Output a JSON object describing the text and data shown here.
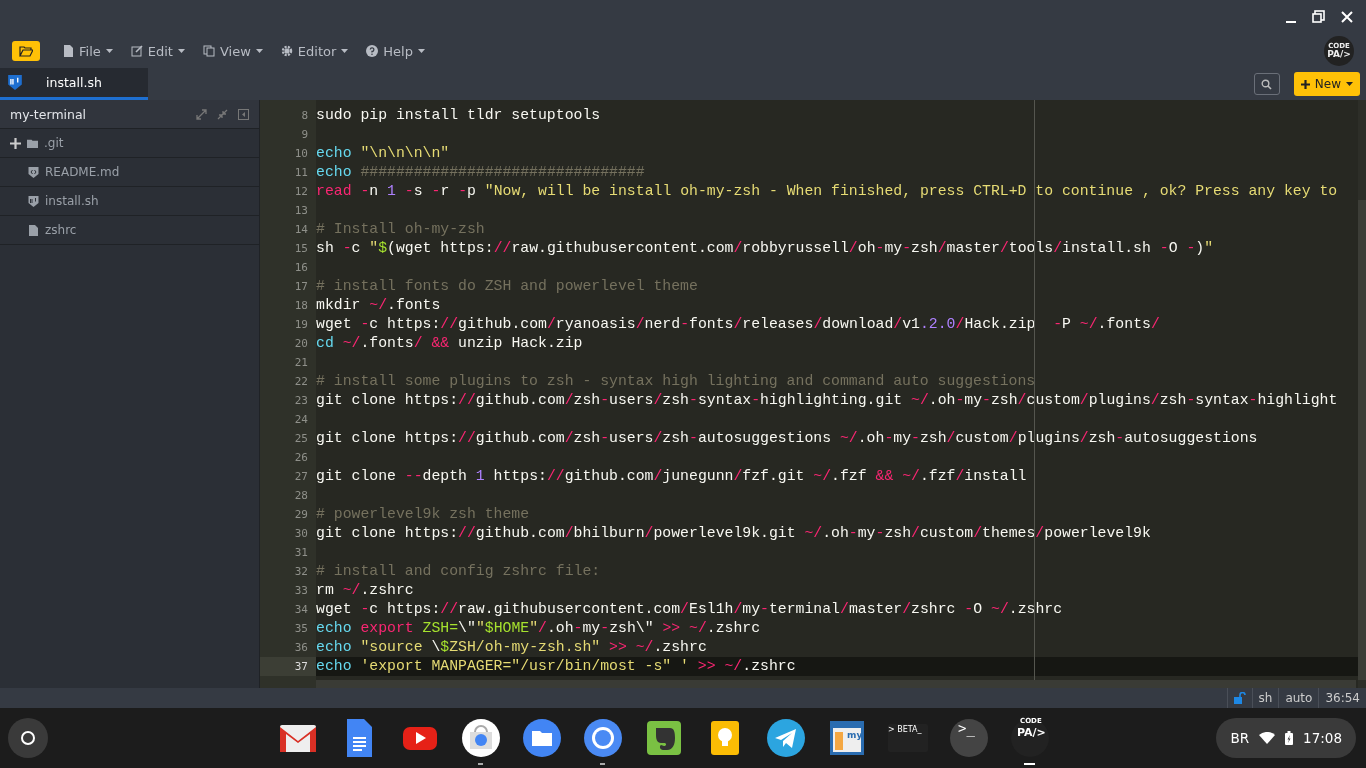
{
  "toolbar": {
    "menus": [
      {
        "label": "File",
        "kind": "file"
      },
      {
        "label": "Edit",
        "kind": "edit"
      },
      {
        "label": "View",
        "kind": "view"
      },
      {
        "label": "Editor",
        "kind": "editor"
      },
      {
        "label": "Help",
        "kind": "help"
      }
    ],
    "logo": {
      "top": "CODE",
      "bottom": "PA/>"
    },
    "new_button": "New"
  },
  "tabs": [
    {
      "label": "install.sh",
      "selected": true
    }
  ],
  "sidebar": {
    "project": "my-terminal",
    "items": [
      {
        "label": ".git",
        "kind": "folder"
      },
      {
        "label": "README.md",
        "kind": "markdown"
      },
      {
        "label": "install.sh",
        "kind": "shell"
      },
      {
        "label": "zshrc",
        "kind": "file"
      }
    ]
  },
  "editor": {
    "lines": [
      {
        "number": "8",
        "active": false,
        "segments": [
          {
            "kind": "plain",
            "text": "sudo pip install tldr setuptools"
          }
        ]
      },
      {
        "number": "9",
        "active": false
      },
      {
        "number": "10",
        "active": false,
        "segments": [
          {
            "kind": "kw",
            "text": "echo "
          },
          {
            "kind": "str",
            "text": "\"\\n\\n\\n\\n\""
          }
        ]
      },
      {
        "number": "11",
        "active": false,
        "segments": [
          {
            "kind": "kw",
            "text": "echo"
          },
          {
            "kind": "comment",
            "text": " ################################"
          }
        ]
      },
      {
        "number": "12",
        "active": false,
        "segments": [
          {
            "kind": "op",
            "text": "read "
          },
          {
            "kind": "op",
            "text": "-"
          },
          {
            "kind": "plain",
            "text": "n "
          },
          {
            "kind": "num",
            "text": "1 "
          },
          {
            "kind": "op",
            "text": "-"
          },
          {
            "kind": "plain",
            "text": "s "
          },
          {
            "kind": "op",
            "text": "-"
          },
          {
            "kind": "plain",
            "text": "r "
          },
          {
            "kind": "op",
            "text": "-"
          },
          {
            "kind": "plain",
            "text": "p "
          },
          {
            "kind": "str",
            "text": "\"Now, will be install oh-my-zsh - When finished, press CTRL+D to continue , ok? Press any key to"
          }
        ]
      },
      {
        "number": "13",
        "active": false
      },
      {
        "number": "14",
        "active": false,
        "segments": [
          {
            "kind": "comment",
            "text": "# Install oh-my-zsh"
          }
        ]
      },
      {
        "number": "15",
        "active": false,
        "segments": [
          {
            "kind": "plain",
            "text": "sh "
          },
          {
            "kind": "op",
            "text": "-"
          },
          {
            "kind": "plain",
            "text": "c "
          },
          {
            "kind": "str",
            "text": "\""
          },
          {
            "kind": "green",
            "text": "$"
          },
          {
            "kind": "plain",
            "text": "(wget https:"
          },
          {
            "kind": "op",
            "text": "//"
          },
          {
            "kind": "plain",
            "text": "raw.githubusercontent.com"
          },
          {
            "kind": "op",
            "text": "/"
          },
          {
            "kind": "plain",
            "text": "robbyrussell"
          },
          {
            "kind": "op",
            "text": "/"
          },
          {
            "kind": "plain",
            "text": "oh"
          },
          {
            "kind": "op",
            "text": "-"
          },
          {
            "kind": "plain",
            "text": "my"
          },
          {
            "kind": "op",
            "text": "-"
          },
          {
            "kind": "plain",
            "text": "zsh"
          },
          {
            "kind": "op",
            "text": "/"
          },
          {
            "kind": "plain",
            "text": "master"
          },
          {
            "kind": "op",
            "text": "/"
          },
          {
            "kind": "plain",
            "text": "tools"
          },
          {
            "kind": "op",
            "text": "/"
          },
          {
            "kind": "plain",
            "text": "install.sh "
          },
          {
            "kind": "op",
            "text": "-"
          },
          {
            "kind": "plain",
            "text": "O "
          },
          {
            "kind": "op",
            "text": "-"
          },
          {
            "kind": "plain",
            "text": ")"
          },
          {
            "kind": "str",
            "text": "\""
          }
        ]
      },
      {
        "number": "16",
        "active": false
      },
      {
        "number": "17",
        "active": false,
        "segments": [
          {
            "kind": "comment",
            "text": "# install fonts do ZSH and powerlevel theme"
          }
        ]
      },
      {
        "number": "18",
        "active": false,
        "segments": [
          {
            "kind": "plain",
            "text": "mkdir "
          },
          {
            "kind": "op",
            "text": "~/"
          },
          {
            "kind": "plain",
            "text": ".fonts"
          }
        ]
      },
      {
        "number": "19",
        "active": false,
        "segments": [
          {
            "kind": "plain",
            "text": "wget "
          },
          {
            "kind": "op",
            "text": "-"
          },
          {
            "kind": "plain",
            "text": "c https:"
          },
          {
            "kind": "op",
            "text": "//"
          },
          {
            "kind": "plain",
            "text": "github.com"
          },
          {
            "kind": "op",
            "text": "/"
          },
          {
            "kind": "plain",
            "text": "ryanoasis"
          },
          {
            "kind": "op",
            "text": "/"
          },
          {
            "kind": "plain",
            "text": "nerd"
          },
          {
            "kind": "op",
            "text": "-"
          },
          {
            "kind": "plain",
            "text": "fonts"
          },
          {
            "kind": "op",
            "text": "/"
          },
          {
            "kind": "plain",
            "text": "releases"
          },
          {
            "kind": "op",
            "text": "/"
          },
          {
            "kind": "plain",
            "text": "download"
          },
          {
            "kind": "op",
            "text": "/"
          },
          {
            "kind": "plain",
            "text": "v1"
          },
          {
            "kind": "num",
            "text": ".2.0"
          },
          {
            "kind": "op",
            "text": "/"
          },
          {
            "kind": "plain",
            "text": "Hack.zip  "
          },
          {
            "kind": "op",
            "text": "-"
          },
          {
            "kind": "plain",
            "text": "P "
          },
          {
            "kind": "op",
            "text": "~/"
          },
          {
            "kind": "plain",
            "text": ".fonts"
          },
          {
            "kind": "op",
            "text": "/"
          }
        ]
      },
      {
        "number": "20",
        "active": false,
        "segments": [
          {
            "kind": "kw",
            "text": "cd "
          },
          {
            "kind": "op",
            "text": "~/"
          },
          {
            "kind": "plain",
            "text": ".fonts"
          },
          {
            "kind": "op",
            "text": "/ &&"
          },
          {
            "kind": "plain",
            "text": " unzip Hack.zip"
          }
        ]
      },
      {
        "number": "21",
        "active": false
      },
      {
        "number": "22",
        "active": false,
        "segments": [
          {
            "kind": "comment",
            "text": "# install some plugins to zsh - syntax high lighting and command auto suggestions"
          }
        ]
      },
      {
        "number": "23",
        "active": false,
        "segments": [
          {
            "kind": "plain",
            "text": "git clone https:"
          },
          {
            "kind": "op",
            "text": "//"
          },
          {
            "kind": "plain",
            "text": "github.com"
          },
          {
            "kind": "op",
            "text": "/"
          },
          {
            "kind": "plain",
            "text": "zsh"
          },
          {
            "kind": "op",
            "text": "-"
          },
          {
            "kind": "plain",
            "text": "users"
          },
          {
            "kind": "op",
            "text": "/"
          },
          {
            "kind": "plain",
            "text": "zsh"
          },
          {
            "kind": "op",
            "text": "-"
          },
          {
            "kind": "plain",
            "text": "syntax"
          },
          {
            "kind": "op",
            "text": "-"
          },
          {
            "kind": "plain",
            "text": "highlighting.git "
          },
          {
            "kind": "op",
            "text": "~/"
          },
          {
            "kind": "plain",
            "text": ".oh"
          },
          {
            "kind": "op",
            "text": "-"
          },
          {
            "kind": "plain",
            "text": "my"
          },
          {
            "kind": "op",
            "text": "-"
          },
          {
            "kind": "plain",
            "text": "zsh"
          },
          {
            "kind": "op",
            "text": "/"
          },
          {
            "kind": "plain",
            "text": "custom"
          },
          {
            "kind": "op",
            "text": "/"
          },
          {
            "kind": "plain",
            "text": "plugins"
          },
          {
            "kind": "op",
            "text": "/"
          },
          {
            "kind": "plain",
            "text": "zsh"
          },
          {
            "kind": "op",
            "text": "-"
          },
          {
            "kind": "plain",
            "text": "syntax"
          },
          {
            "kind": "op",
            "text": "-"
          },
          {
            "kind": "plain",
            "text": "highlight"
          }
        ]
      },
      {
        "number": "24",
        "active": false
      },
      {
        "number": "25",
        "active": false,
        "segments": [
          {
            "kind": "plain",
            "text": "git clone https:"
          },
          {
            "kind": "op",
            "text": "//"
          },
          {
            "kind": "plain",
            "text": "github.com"
          },
          {
            "kind": "op",
            "text": "/"
          },
          {
            "kind": "plain",
            "text": "zsh"
          },
          {
            "kind": "op",
            "text": "-"
          },
          {
            "kind": "plain",
            "text": "users"
          },
          {
            "kind": "op",
            "text": "/"
          },
          {
            "kind": "plain",
            "text": "zsh"
          },
          {
            "kind": "op",
            "text": "-"
          },
          {
            "kind": "plain",
            "text": "autosuggestions "
          },
          {
            "kind": "op",
            "text": "~/"
          },
          {
            "kind": "plain",
            "text": ".oh"
          },
          {
            "kind": "op",
            "text": "-"
          },
          {
            "kind": "plain",
            "text": "my"
          },
          {
            "kind": "op",
            "text": "-"
          },
          {
            "kind": "plain",
            "text": "zsh"
          },
          {
            "kind": "op",
            "text": "/"
          },
          {
            "kind": "plain",
            "text": "custom"
          },
          {
            "kind": "op",
            "text": "/"
          },
          {
            "kind": "plain",
            "text": "plugins"
          },
          {
            "kind": "op",
            "text": "/"
          },
          {
            "kind": "plain",
            "text": "zsh"
          },
          {
            "kind": "op",
            "text": "-"
          },
          {
            "kind": "plain",
            "text": "autosuggestions"
          }
        ]
      },
      {
        "number": "26",
        "active": false
      },
      {
        "number": "27",
        "active": false,
        "segments": [
          {
            "kind": "plain",
            "text": "git clone "
          },
          {
            "kind": "op",
            "text": "--"
          },
          {
            "kind": "plain",
            "text": "depth "
          },
          {
            "kind": "num",
            "text": "1"
          },
          {
            "kind": "plain",
            "text": " https:"
          },
          {
            "kind": "op",
            "text": "//"
          },
          {
            "kind": "plain",
            "text": "github.com"
          },
          {
            "kind": "op",
            "text": "/"
          },
          {
            "kind": "plain",
            "text": "junegunn"
          },
          {
            "kind": "op",
            "text": "/"
          },
          {
            "kind": "plain",
            "text": "fzf.git "
          },
          {
            "kind": "op",
            "text": "~/"
          },
          {
            "kind": "plain",
            "text": ".fzf "
          },
          {
            "kind": "op",
            "text": "&& ~/"
          },
          {
            "kind": "plain",
            "text": ".fzf"
          },
          {
            "kind": "op",
            "text": "/"
          },
          {
            "kind": "plain",
            "text": "install"
          }
        ]
      },
      {
        "number": "28",
        "active": false
      },
      {
        "number": "29",
        "active": false,
        "segments": [
          {
            "kind": "comment",
            "text": "# powerlevel9k zsh theme"
          }
        ]
      },
      {
        "number": "30",
        "active": false,
        "segments": [
          {
            "kind": "plain",
            "text": "git clone https:"
          },
          {
            "kind": "op",
            "text": "//"
          },
          {
            "kind": "plain",
            "text": "github.com"
          },
          {
            "kind": "op",
            "text": "/"
          },
          {
            "kind": "plain",
            "text": "bhilburn"
          },
          {
            "kind": "op",
            "text": "/"
          },
          {
            "kind": "plain",
            "text": "powerlevel9k.git "
          },
          {
            "kind": "op",
            "text": "~/"
          },
          {
            "kind": "plain",
            "text": ".oh"
          },
          {
            "kind": "op",
            "text": "-"
          },
          {
            "kind": "plain",
            "text": "my"
          },
          {
            "kind": "op",
            "text": "-"
          },
          {
            "kind": "plain",
            "text": "zsh"
          },
          {
            "kind": "op",
            "text": "/"
          },
          {
            "kind": "plain",
            "text": "custom"
          },
          {
            "kind": "op",
            "text": "/"
          },
          {
            "kind": "plain",
            "text": "themes"
          },
          {
            "kind": "op",
            "text": "/"
          },
          {
            "kind": "plain",
            "text": "powerlevel9k"
          }
        ]
      },
      {
        "number": "31",
        "active": false
      },
      {
        "number": "32",
        "active": false,
        "segments": [
          {
            "kind": "comment",
            "text": "# install and config zshrc file:"
          }
        ]
      },
      {
        "number": "33",
        "active": false,
        "segments": [
          {
            "kind": "plain",
            "text": "rm "
          },
          {
            "kind": "op",
            "text": "~/"
          },
          {
            "kind": "plain",
            "text": ".zshrc"
          }
        ]
      },
      {
        "number": "34",
        "active": false,
        "segments": [
          {
            "kind": "plain",
            "text": "wget "
          },
          {
            "kind": "op",
            "text": "-"
          },
          {
            "kind": "plain",
            "text": "c https:"
          },
          {
            "kind": "op",
            "text": "//"
          },
          {
            "kind": "plain",
            "text": "raw.githubusercontent.com"
          },
          {
            "kind": "op",
            "text": "/"
          },
          {
            "kind": "plain",
            "text": "Esl1h"
          },
          {
            "kind": "op",
            "text": "/"
          },
          {
            "kind": "plain",
            "text": "my"
          },
          {
            "kind": "op",
            "text": "-"
          },
          {
            "kind": "plain",
            "text": "terminal"
          },
          {
            "kind": "op",
            "text": "/"
          },
          {
            "kind": "plain",
            "text": "master"
          },
          {
            "kind": "op",
            "text": "/"
          },
          {
            "kind": "plain",
            "text": "zshrc "
          },
          {
            "kind": "op",
            "text": "-"
          },
          {
            "kind": "plain",
            "text": "O "
          },
          {
            "kind": "op",
            "text": "~/"
          },
          {
            "kind": "plain",
            "text": ".zshrc"
          }
        ]
      },
      {
        "number": "35",
        "active": false,
        "segments": [
          {
            "kind": "kw",
            "text": "echo "
          },
          {
            "kind": "op",
            "text": "export "
          },
          {
            "kind": "green",
            "text": "ZSH="
          },
          {
            "kind": "plain",
            "text": "\\\""
          },
          {
            "kind": "str",
            "text": "\""
          },
          {
            "kind": "green",
            "text": "$HOME"
          },
          {
            "kind": "str",
            "text": "\""
          },
          {
            "kind": "op",
            "text": "/"
          },
          {
            "kind": "plain",
            "text": ".oh"
          },
          {
            "kind": "op",
            "text": "-"
          },
          {
            "kind": "plain",
            "text": "my"
          },
          {
            "kind": "op",
            "text": "-"
          },
          {
            "kind": "plain",
            "text": "zsh\\\" "
          },
          {
            "kind": "op",
            "text": ">> ~/"
          },
          {
            "kind": "plain",
            "text": ".zshrc"
          }
        ]
      },
      {
        "number": "36",
        "active": false,
        "segments": [
          {
            "kind": "kw",
            "text": "echo "
          },
          {
            "kind": "str",
            "text": "\"source "
          },
          {
            "kind": "plain",
            "text": "\\"
          },
          {
            "kind": "green",
            "text": "$"
          },
          {
            "kind": "str",
            "text": "ZSH/oh-my-zsh.sh\" "
          },
          {
            "kind": "op",
            "text": ">> ~/"
          },
          {
            "kind": "plain",
            "text": ".zshrc"
          }
        ]
      },
      {
        "number": "37",
        "active": true,
        "segments": [
          {
            "kind": "kw",
            "text": "echo "
          },
          {
            "kind": "str",
            "text": "'export MANPAGER=\"/usr/bin/most -s\" ' "
          },
          {
            "kind": "op",
            "text": ">> ~/"
          },
          {
            "kind": "plain",
            "text": ".zshrc"
          }
        ]
      }
    ]
  },
  "status_bar": {
    "mode": "sh",
    "indent": "auto",
    "position": "36:54"
  },
  "shelf": {
    "apps": [
      {
        "kind": "mail",
        "running": false,
        "focused": false
      },
      {
        "kind": "docs",
        "running": false,
        "focused": false
      },
      {
        "kind": "video",
        "running": false,
        "focused": false
      },
      {
        "kind": "store",
        "running": true,
        "focused": false
      },
      {
        "kind": "files",
        "running": false,
        "focused": false
      },
      {
        "kind": "browser",
        "running": true,
        "focused": false
      },
      {
        "kind": "notes",
        "running": false,
        "focused": false
      },
      {
        "kind": "bulb",
        "running": false,
        "focused": false
      },
      {
        "kind": "plane",
        "running": false,
        "focused": false
      },
      {
        "kind": "window",
        "running": false,
        "focused": false,
        "label": "my"
      },
      {
        "kind": "beta",
        "running": false,
        "focused": false,
        "label": "> BETA_"
      },
      {
        "kind": "terminal",
        "running": false,
        "focused": false,
        "label": ">_"
      },
      {
        "kind": "codepad",
        "running": true,
        "focused": true,
        "label": "CODE",
        "label2": "PA/>"
      }
    ],
    "tray": {
      "keyboard": "BR",
      "time": "17:08"
    }
  }
}
